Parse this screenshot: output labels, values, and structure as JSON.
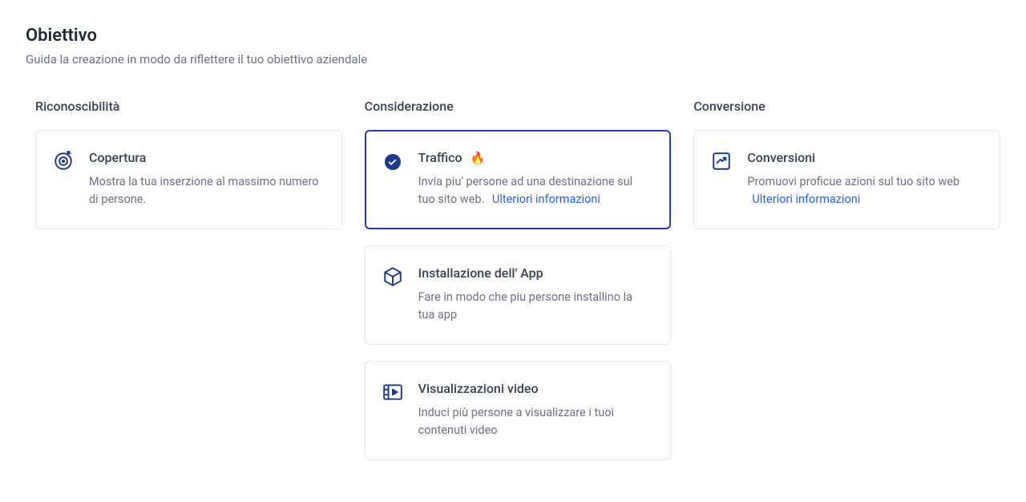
{
  "header": {
    "title": "Obiettivo",
    "subtitle": "Guida la creazione in modo da riflettere il tuo obiettivo aziendale"
  },
  "columns": {
    "awareness": {
      "heading": "Riconoscibilità",
      "cards": {
        "reach": {
          "title": "Copertura",
          "desc": "Mostra la tua inserzione al massimo numero di persone."
        }
      }
    },
    "consideration": {
      "heading": "Considerazione",
      "cards": {
        "traffic": {
          "title": "Traffico",
          "desc": "Invia piu' persone ad una destinazione sul tuo sito web.",
          "learn_more": "Ulteriori informazioni"
        },
        "app_install": {
          "title": "Installazione dell' App",
          "desc": "Fare in modo che piu persone installino la tua app"
        },
        "video_views": {
          "title": "Visualizzazioni video",
          "desc": "Induci più persone a visualizzare i tuoi contenuti video"
        }
      }
    },
    "conversion": {
      "heading": "Conversione",
      "cards": {
        "conversions": {
          "title": "Conversioni",
          "desc": "Promuovi proficue azioni sul tuo sito web",
          "learn_more": "Ulteriori informazioni"
        }
      }
    }
  }
}
